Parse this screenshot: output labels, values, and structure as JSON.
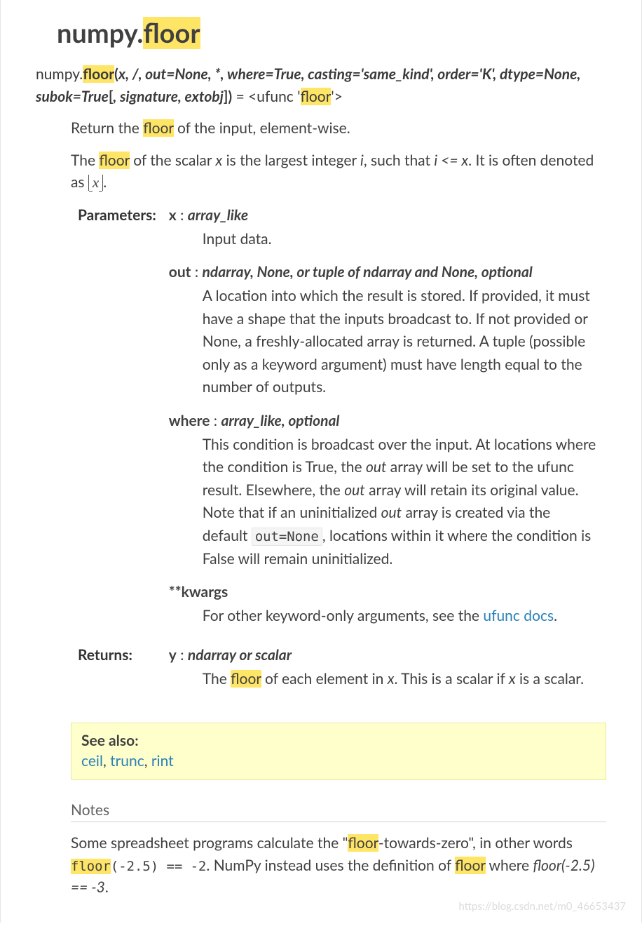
{
  "title": {
    "prefix": "numpy.",
    "name": "floor"
  },
  "signature": {
    "ns": "numpy.",
    "fn": "floor",
    "open": "(",
    "args": "x, /, out=None, *, where=True, casting='same_kind', order='K', dtype=None, subok=True",
    "bracket_open": "[",
    "bracket_args": ", signature, extobj",
    "bracket_close": "]",
    "close": ")",
    "eq": " = ",
    "ufunc_open": "<ufunc '",
    "ufunc_name": "floor",
    "ufunc_close": "'>"
  },
  "intro": {
    "line1a": "Return the ",
    "line1hl": "floor",
    "line1b": " of the input, element-wise.",
    "line2a": "The ",
    "line2hl": "floor",
    "line2b": " of the scalar ",
    "line2x": "x",
    "line2c": " is the largest integer ",
    "line2i": "i",
    "line2d": ", such that ",
    "line2i2": "i <= x",
    "line2e": ". It is often denoted as ",
    "line2mathvar": "x",
    "line2f": "."
  },
  "field_labels": {
    "parameters": "Parameters:",
    "returns": "Returns:"
  },
  "params": {
    "x": {
      "name": "x",
      "colon": " : ",
      "type": "array_like",
      "desc": "Input data."
    },
    "out": {
      "name": "out",
      "colon": " : ",
      "type": "ndarray, None, or tuple of ndarray and None, optional",
      "desc": "A location into which the result is stored. If provided, it must have a shape that the inputs broadcast to. If not provided or None, a freshly-allocated array is returned. A tuple (possible only as a keyword argument) must have length equal to the number of outputs."
    },
    "where": {
      "name": "where",
      "colon": " : ",
      "type": "array_like, optional",
      "desc_a": "This condition is broadcast over the input. At locations where the condition is True, the ",
      "out1": "out",
      "desc_b": " array will be set to the ufunc result. Elsewhere, the ",
      "out2": "out",
      "desc_c": " array will retain its original value. Note that if an uninitialized ",
      "out3": "out",
      "desc_d": " array is created via the default ",
      "code": "out=None",
      "desc_e": ", locations within it where the condition is False will remain uninitialized."
    },
    "kwargs": {
      "name": "**kwargs",
      "desc_a": "For other keyword-only arguments, see the ",
      "link": "ufunc docs",
      "desc_b": "."
    }
  },
  "returns": {
    "y": {
      "name": "y",
      "colon": " : ",
      "type": "ndarray or scalar",
      "desc_a": "The ",
      "hl": "floor",
      "desc_b": " of each element in ",
      "x1": "x",
      "desc_c": ". This is a scalar if ",
      "x2": "x",
      "desc_d": " is a scalar."
    }
  },
  "seealso": {
    "title": "See also:",
    "links": [
      "ceil",
      "trunc",
      "rint"
    ],
    "sep": ", "
  },
  "notes": {
    "heading": "Notes",
    "a": "Some spreadsheet programs calculate the \"",
    "hl1": "floor",
    "b": "-towards-zero\", in other words ",
    "code_pre": "floor",
    "code_rest": "(-2.5) == -2",
    "c": ". NumPy instead uses the definition of ",
    "hl2": "floor",
    "d": " where ",
    "ital": "floor(-2.5) == -3",
    "e": "."
  },
  "watermark": "https://blog.csdn.net/m0_46653437"
}
